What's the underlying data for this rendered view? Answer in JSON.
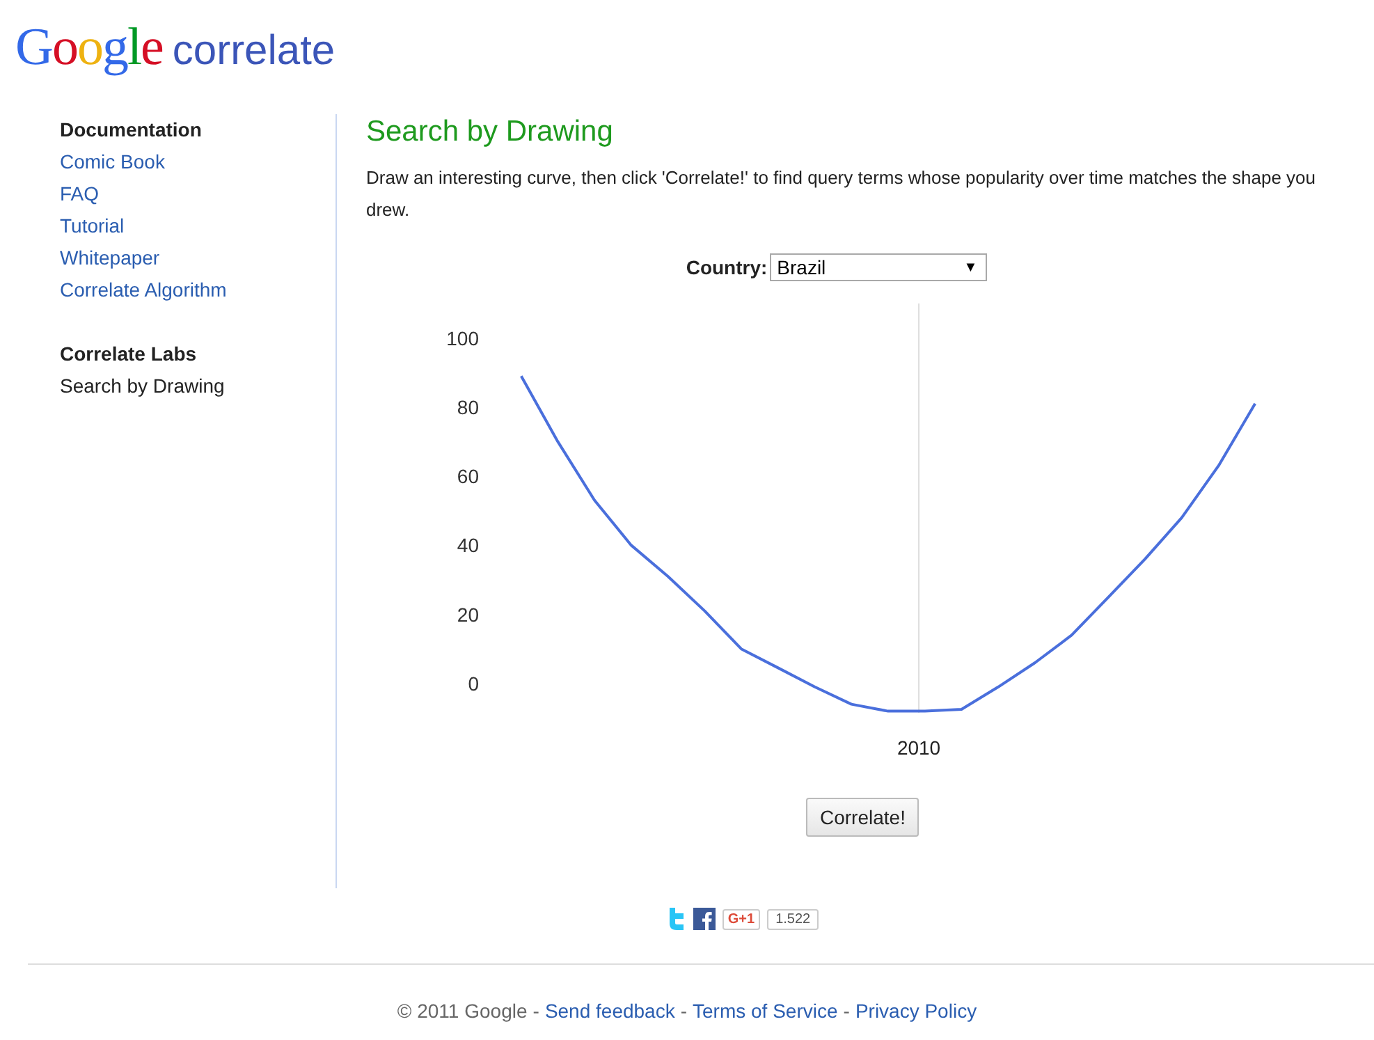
{
  "logo": {
    "brand": "Google",
    "product": "correlate"
  },
  "sidebar": [
    {
      "heading": "Documentation",
      "items": [
        {
          "label": "Comic Book",
          "selected": false
        },
        {
          "label": "FAQ",
          "selected": false
        },
        {
          "label": "Tutorial",
          "selected": false
        },
        {
          "label": "Whitepaper",
          "selected": false
        },
        {
          "label": "Correlate Algorithm",
          "selected": false
        }
      ]
    },
    {
      "heading": "Correlate Labs",
      "items": [
        {
          "label": "Search by Drawing",
          "selected": true
        }
      ]
    }
  ],
  "main": {
    "title": "Search by Drawing",
    "description": "Draw an interesting curve, then click 'Correlate!' to find query terms whose popularity over time matches the shape you drew.",
    "country": {
      "label": "Country:",
      "value": "Brazil",
      "arrow": "▼"
    },
    "chart_data": {
      "type": "line",
      "series": [
        {
          "color": "#4a6fdc",
          "values": [
            null,
            89,
            70,
            53,
            40,
            31,
            21,
            10,
            4.5,
            -1,
            -6,
            -8,
            -8,
            -7.5,
            -1,
            6,
            14,
            25,
            36,
            48,
            63,
            81,
            null
          ]
        }
      ],
      "ylim": [
        -8.5,
        110
      ],
      "yticks": [
        0,
        20,
        40,
        60,
        80,
        100
      ],
      "annotations": [
        "2010"
      ]
    },
    "button": "Correlate!"
  },
  "social": {
    "plus_label": "G+1",
    "count": "1.522"
  },
  "footer_separator": "-",
  "footer": [
    {
      "text": "© 2011 Google",
      "kind": "text"
    },
    {
      "text": "Send feedback",
      "kind": "link"
    },
    {
      "text": "Terms of Service",
      "kind": "link"
    },
    {
      "text": "Privacy Policy",
      "kind": "link"
    }
  ]
}
